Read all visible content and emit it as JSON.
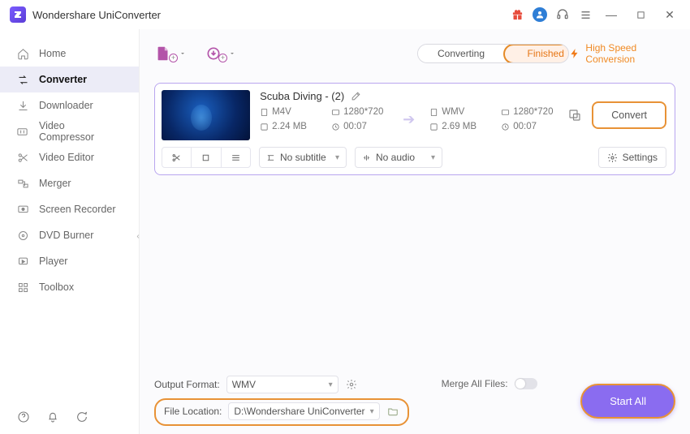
{
  "app": {
    "title": "Wondershare UniConverter"
  },
  "titlebar_icons": [
    "gift-icon",
    "user-icon",
    "headset-icon",
    "menu-icon"
  ],
  "window_controls": [
    "minimize",
    "maximize",
    "close"
  ],
  "sidebar": {
    "items": [
      {
        "label": "Home",
        "icon": "home-icon"
      },
      {
        "label": "Converter",
        "icon": "converter-icon",
        "active": true
      },
      {
        "label": "Downloader",
        "icon": "download-icon"
      },
      {
        "label": "Video Compressor",
        "icon": "compress-icon"
      },
      {
        "label": "Video Editor",
        "icon": "scissors-icon"
      },
      {
        "label": "Merger",
        "icon": "merge-icon"
      },
      {
        "label": "Screen Recorder",
        "icon": "record-icon"
      },
      {
        "label": "DVD Burner",
        "icon": "disc-icon"
      },
      {
        "label": "Player",
        "icon": "play-icon"
      },
      {
        "label": "Toolbox",
        "icon": "grid-icon"
      }
    ],
    "footer_icons": [
      "help-icon",
      "bell-icon",
      "feedback-icon"
    ]
  },
  "toolbar": {
    "add_file_icon": "add-file-icon",
    "add_folder_icon": "add-download-icon",
    "tabs": [
      {
        "label": "Converting",
        "active": false
      },
      {
        "label": "Finished",
        "active": true
      }
    ],
    "high_speed_label": "High Speed Conversion"
  },
  "file": {
    "title": "Scuba Diving - (2)",
    "source": {
      "format": "M4V",
      "resolution": "1280*720",
      "size": "2.24 MB",
      "duration": "00:07"
    },
    "target": {
      "format": "WMV",
      "resolution": "1280*720",
      "size": "2.69 MB",
      "duration": "00:07"
    },
    "subtitle_select": "No subtitle",
    "audio_select": "No audio",
    "settings_label": "Settings",
    "convert_label": "Convert"
  },
  "footer": {
    "output_format_label": "Output Format:",
    "output_format_value": "WMV",
    "file_location_label": "File Location:",
    "file_location_value": "D:\\Wondershare UniConverter",
    "merge_label": "Merge All Files:",
    "start_all_label": "Start All"
  }
}
